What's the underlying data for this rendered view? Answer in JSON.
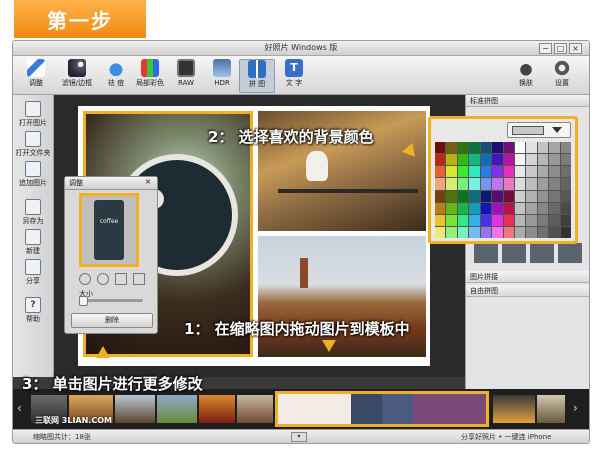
{
  "banner": {
    "text": "第一步"
  },
  "window": {
    "title": "好照片 Windows 版",
    "controls": [
      "−",
      "□",
      "×"
    ]
  },
  "toolbar": {
    "items": [
      {
        "label": "调整",
        "icon": "pencil-icon"
      },
      {
        "label": "滤镜/边框",
        "icon": "wand-icon"
      },
      {
        "label": "祛 痘",
        "icon": "drop-icon"
      },
      {
        "label": "局部彩色",
        "icon": "palette-icon"
      },
      {
        "label": "RAW",
        "icon": "camera-icon"
      },
      {
        "label": "HDR",
        "icon": "hdr-icon"
      },
      {
        "label": "拼 图",
        "icon": "collage-icon"
      },
      {
        "label": "文 字",
        "icon": "text-icon"
      }
    ],
    "right_items": [
      {
        "label": "换肤",
        "icon": "shirt-icon"
      },
      {
        "label": "设置",
        "icon": "gear-icon"
      }
    ]
  },
  "sidebar": {
    "items": [
      {
        "label": "打开图片",
        "icon": "open-image-icon"
      },
      {
        "label": "打开文件夹",
        "icon": "open-folder-icon"
      },
      {
        "label": "追加图片",
        "icon": "add-image-icon"
      },
      {
        "label": "另存为",
        "icon": "save-icon"
      },
      {
        "label": "新建",
        "icon": "new-icon"
      },
      {
        "label": "分享",
        "icon": "share-icon"
      },
      {
        "label": "帮助",
        "icon": "help-icon"
      }
    ]
  },
  "dialog": {
    "title": "调整",
    "close": "×",
    "size_label": "大小",
    "delete_label": "删除",
    "photo_text": "coffee"
  },
  "right_panel": {
    "sections": [
      {
        "label": "标准拼图"
      },
      {
        "label": "图片拼接"
      },
      {
        "label": "自由拼图"
      }
    ]
  },
  "color_picker": {
    "selected": "#c8c8c8"
  },
  "annotations": {
    "step1": "1：  在缩略图内拖动图片到模板中",
    "step2": "2：  选择喜欢的背景颜色",
    "step3": "3：  单击图片进行更多修改"
  },
  "filmstrip": {
    "watermark": "三联网 3LIAN.COM"
  },
  "status": {
    "left": "缩略图共计：18张",
    "right": "分享好照片 • 一键连 iPhone"
  },
  "colors": {
    "accent": "#f0b021",
    "banner": "#f59a1c"
  }
}
